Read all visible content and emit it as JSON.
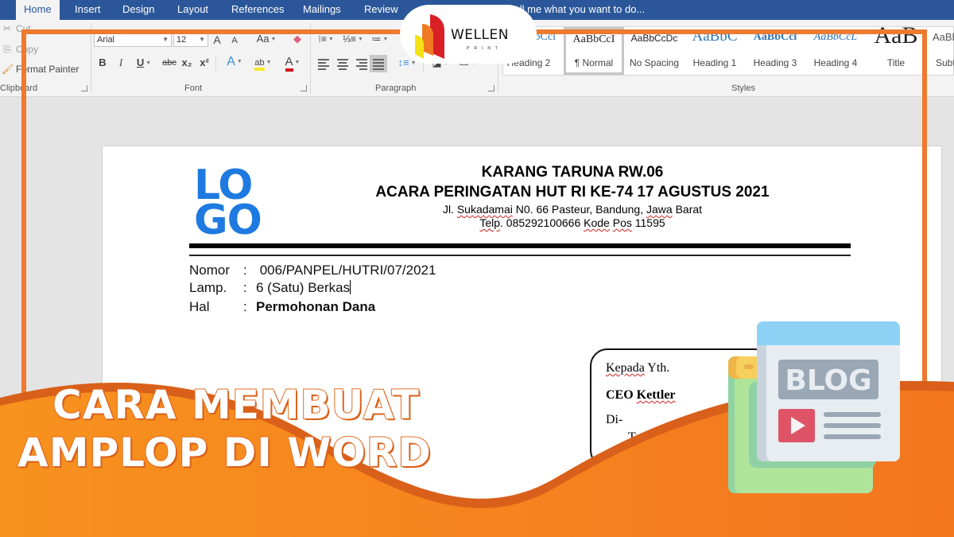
{
  "app": {
    "tabs": [
      {
        "label": "Home",
        "active": true
      },
      {
        "label": "Insert"
      },
      {
        "label": "Design"
      },
      {
        "label": "Layout"
      },
      {
        "label": "References"
      },
      {
        "label": "Mailings"
      },
      {
        "label": "Review"
      }
    ],
    "tell_me": "Tell me what you want to do..."
  },
  "ribbon": {
    "clipboard": {
      "cut": "Cut",
      "copy": "Copy",
      "format_painter": "Format Painter",
      "label": "Clipboard"
    },
    "font": {
      "family": "Arial",
      "size": "12",
      "grow": "A",
      "shrink": "A",
      "change_case": "Aa",
      "bold": "B",
      "italic": "I",
      "underline": "U",
      "strike": "abc",
      "subscript": "x₂",
      "superscript": "x²",
      "text_effects": "A",
      "highlight": "ab",
      "font_color": "A",
      "label": "Font",
      "highlight_color": "#f5e72a",
      "font_color_value": "#d0121b"
    },
    "paragraph": {
      "label": "Paragraph"
    },
    "styles": {
      "label": "Styles",
      "items": [
        {
          "sample": "AaBbCcl",
          "name": "Heading 2"
        },
        {
          "sample": "AaBbCcI",
          "name": "¶ Normal",
          "selected": true
        },
        {
          "sample": "AaBbCcDc",
          "name": "No Spacing"
        },
        {
          "sample": "AaBbC",
          "name": "Heading 1"
        },
        {
          "sample": "AaBbCcl",
          "name": "Heading 3"
        },
        {
          "sample": "AaBbCcL",
          "name": "Heading 4"
        },
        {
          "sample": "AaB",
          "name": "Title"
        },
        {
          "sample": "AaBbC",
          "name": "Subtitle"
        }
      ]
    }
  },
  "document": {
    "logo": {
      "line1": "LO",
      "line2": "GO",
      "color": "#1e7ae0"
    },
    "header": {
      "org": "KARANG TARUNA RW.06",
      "event": "ACARA PERINGATAN HUT RI KE-74 17 AGUSTUS 2021",
      "address_pre": "Jl. ",
      "address_sq1": "Sukadamai",
      "address_mid": " N0. 66 Pasteur, Bandung, ",
      "address_sq2": "Jawa",
      "address_post": " Barat",
      "phone_sq1": "Telp",
      "phone_mid": ". 085292100666 ",
      "phone_sq2": "Kode",
      "phone_sp": " ",
      "phone_sq3": "Pos",
      "phone_post": " 11595"
    },
    "meta": [
      {
        "key": "Nomor",
        "sep": ":",
        "value": " 006/PANPEL/HUTRI/07/2021"
      },
      {
        "key": "Lamp.",
        "sep": ":",
        "value": "6 (Satu) Berkas"
      },
      {
        "key": "Hal",
        "sep": ":",
        "value": "Permohonan Dana"
      }
    ],
    "recipient": {
      "greeting_sq": "Kepada",
      "greeting_post": " Yth.",
      "name_pre": "CEO ",
      "name_sq": "Kettler",
      "di": "Di-",
      "place": "Tempat"
    }
  },
  "overlay": {
    "title_line1": "CARA MEMBUAT",
    "title_line2": "AMPLOP DI WORD",
    "brand": "WELLEN",
    "brand_sub": "PRINT",
    "blog_label": "BLOG",
    "accent": "#ee7a2f"
  }
}
